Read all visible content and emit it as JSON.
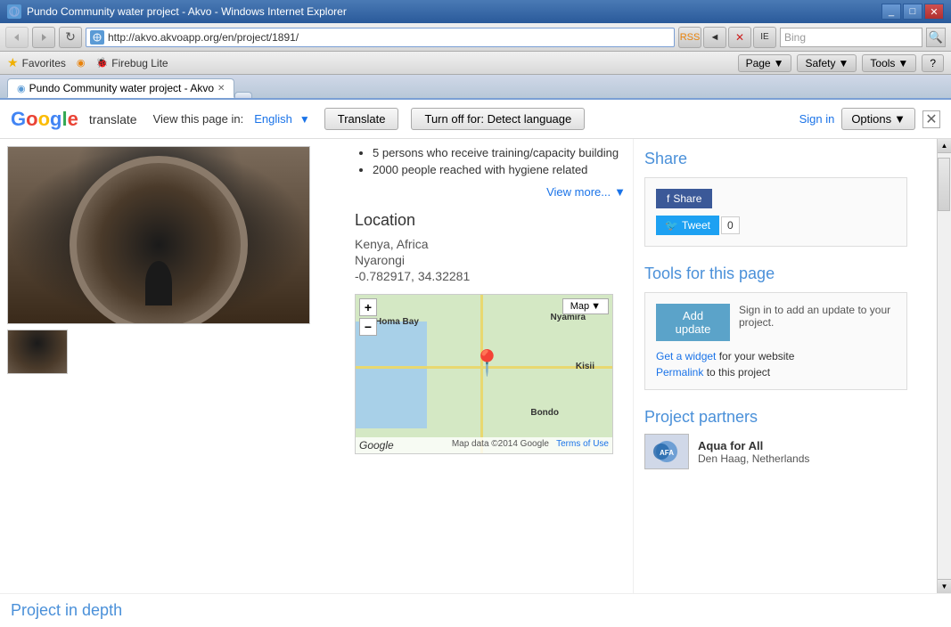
{
  "browser": {
    "title": "Pundo Community water project - Akvo - Windows Internet Explorer",
    "tab_label": "Pundo Community water project - Akvo",
    "address": "http://akvo.akvoapp.org/en/project/1891/",
    "search_placeholder": "Bing"
  },
  "translate_bar": {
    "google_translate": "Google translate",
    "view_page_in": "View this page in:",
    "language": "English",
    "translate_btn": "Translate",
    "turn_off": "Turn off for: Detect language",
    "sign_in": "Sign in",
    "options": "Options"
  },
  "bullets": [
    "5 persons who receive training/capacity building",
    "2000 people reached with hygiene related"
  ],
  "view_more": "View more...",
  "location": {
    "title": "Location",
    "country": "Kenya, Africa",
    "region": "Nyarongi",
    "coords": "-0.782917, 34.32281"
  },
  "map": {
    "type_btn": "Map",
    "zoom_in": "+",
    "zoom_out": "−",
    "footer": "Map data ©2014 Google",
    "terms": "Terms of Use",
    "labels": [
      "Homa Bay",
      "Nyamira",
      "Kisii",
      "Bondo"
    ]
  },
  "share": {
    "title": "Share",
    "fb_btn": "Share",
    "tweet_btn": "Tweet",
    "tweet_count": "0"
  },
  "tools": {
    "title": "Tools for this page",
    "add_update_btn": "Add update",
    "update_desc": "Sign in to add an update to your project.",
    "widget_text": "Get a widget",
    "widget_suffix": "for your website",
    "permalink_text": "Permalink",
    "permalink_suffix": "to this project"
  },
  "partners": {
    "title": "Project partners",
    "partner_name": "Aqua for All",
    "partner_location": "Den Haag, Netherlands"
  },
  "project_depth": {
    "title": "Project in depth"
  },
  "nav": {
    "back": "◄",
    "forward": "►",
    "stop": "✕",
    "refresh": "↻",
    "home": "⌂",
    "page_label": "Page",
    "safety_label": "Safety",
    "tools_label": "Tools",
    "help": "?",
    "favorites": "Favorites",
    "firebug": "Firebug Lite"
  }
}
